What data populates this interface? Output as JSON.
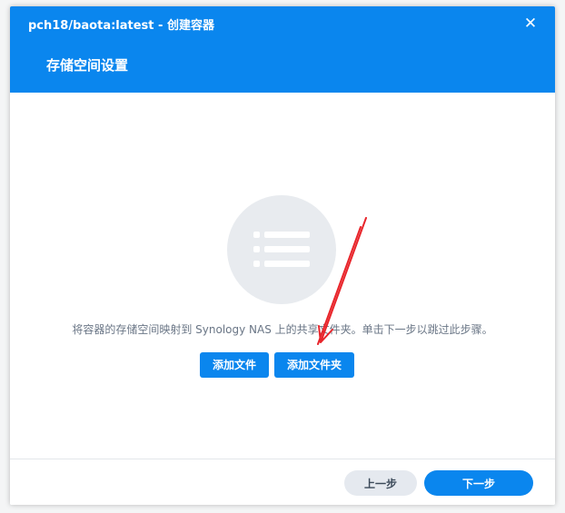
{
  "window": {
    "title": "pch18/baota:latest - 创建容器",
    "close_label": "✕"
  },
  "header": {
    "page_title": "存储空间设置"
  },
  "main": {
    "illustration_icon": "list-icon",
    "hint_text": "将容器的存储空间映射到 Synology NAS 上的共享文件夹。单击下一步以跳过此步骤。",
    "add_file_label": "添加文件",
    "add_folder_label": "添加文件夹"
  },
  "footer": {
    "prev_label": "上一步",
    "next_label": "下一步"
  },
  "colors": {
    "accent": "#0a86ee",
    "annotation_arrow": "#e8242a"
  }
}
